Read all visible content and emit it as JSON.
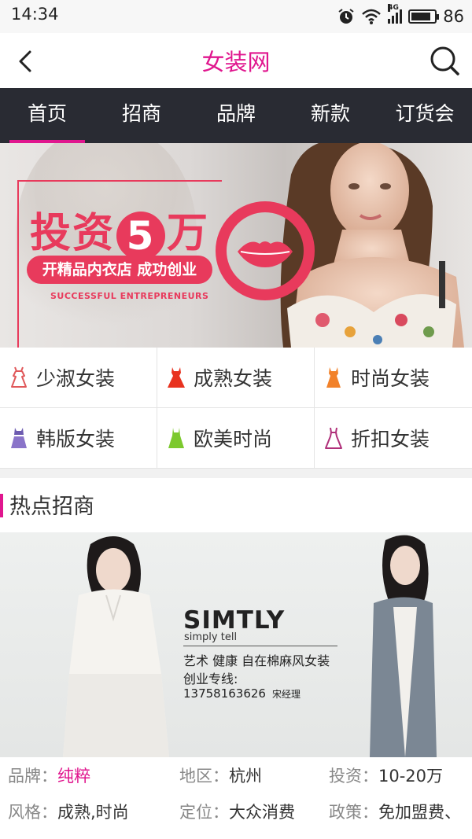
{
  "status_bar": {
    "time": "14:34",
    "network": "4G",
    "battery": "86",
    "battery_level": 0.86,
    "icons": [
      "alarm-icon",
      "wifi-icon",
      "signal-icon",
      "battery-icon"
    ]
  },
  "header": {
    "title": "女装网",
    "back_icon": "chevron-left-icon",
    "search_icon": "search-icon"
  },
  "nav": {
    "tabs": [
      {
        "label": "首页",
        "active": true
      },
      {
        "label": "招商",
        "active": false
      },
      {
        "label": "品牌",
        "active": false
      },
      {
        "label": "新款",
        "active": false
      },
      {
        "label": "订货会",
        "active": false
      }
    ]
  },
  "banner": {
    "headline_1": "投资",
    "headline_num": "5",
    "headline_2": "万",
    "pill": "开精品内衣店 成功创业",
    "english": "SUCCESSFUL ENTREPRENEURS"
  },
  "categories": [
    {
      "label": "少淑女装",
      "icon": "dress-outline-icon",
      "color": "#e0585a"
    },
    {
      "label": "成熟女装",
      "icon": "dress-icon",
      "color": "#e8321f"
    },
    {
      "label": "时尚女装",
      "icon": "dress-icon",
      "color": "#f2822a"
    },
    {
      "label": "韩版女装",
      "icon": "dress-icon",
      "color": "#8a74c9"
    },
    {
      "label": "欧美时尚",
      "icon": "dress-icon",
      "color": "#7cc92e"
    },
    {
      "label": "折扣女装",
      "icon": "dress-outline-icon",
      "color": "#b0307a"
    }
  ],
  "section": {
    "title": "热点招商"
  },
  "ad": {
    "brand": "SIMTLY",
    "tagline": "simply tell",
    "description": "艺术 健康 自在棉麻风女装",
    "hotline": "创业专线:",
    "phone": "13758163626",
    "contact": "宋经理"
  },
  "info": {
    "row1": [
      {
        "label": "品牌：",
        "value": "纯粹"
      },
      {
        "label": "地区：",
        "value": "杭州"
      },
      {
        "label": "投资：",
        "value": "10-20万"
      }
    ],
    "row2": [
      {
        "label": "风格：",
        "value": "成熟,时尚"
      },
      {
        "label": "定位：",
        "value": "大众消费"
      },
      {
        "label": "政策：",
        "value": "免加盟费、"
      }
    ]
  },
  "colors": {
    "accent": "#e0168e",
    "nav_bg": "#292b33",
    "banner_red": "#e83a5c"
  }
}
